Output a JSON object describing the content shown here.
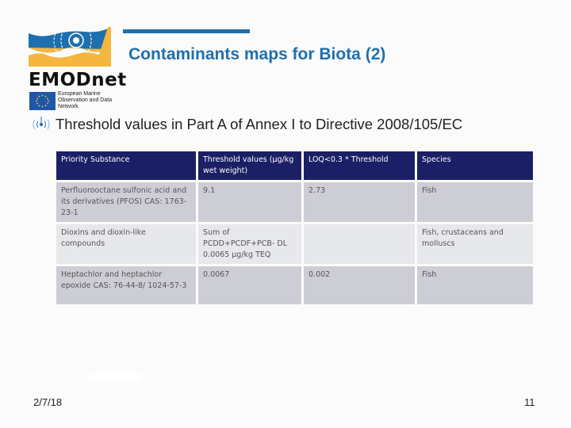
{
  "header": {
    "title": "Contaminants maps for Biota (2)",
    "subtitle": "Threshold values in Part A of Annex I to Directive 2008/105/EC"
  },
  "logo": {
    "name": "EMODnet",
    "tagline": "European Marine Observation and Data Network",
    "icon": "emodnet-wave-logo-icon",
    "colors": {
      "blue": "#1f6fae",
      "orange": "#f4b63f"
    }
  },
  "table": {
    "columns": [
      "Priority Substance",
      "Threshold values (µg/kg wet weight)",
      "LOQ<0.3 * Threshold",
      "Species"
    ],
    "rows": [
      {
        "substance": "Perfluorooctane sulfonic acid and its derivatives (PFOS) CAS: 1763-23-1",
        "threshold": "9.1",
        "loq": "2.73",
        "species": "Fish"
      },
      {
        "substance": "Dioxins and dioxin-like compounds",
        "threshold": "Sum of PCDD+PCDF+PCB- DL 0.0065 µg/kg  TEQ",
        "loq": "",
        "species": "Fish, crustaceans and molluscs"
      },
      {
        "substance": "Heptachlor and heptachlor epoxide CAS: 76-44-8/ 1024-57-3",
        "threshold": "0.0067",
        "loq": "0.002",
        "species": "Fish"
      }
    ]
  },
  "footer": {
    "date": "2/7/18",
    "page": "11"
  },
  "colors": {
    "title": "#1f6fae",
    "table_header": "#1b1f66",
    "row_dark": "#cdced5",
    "row_light": "#e7e8eb"
  }
}
